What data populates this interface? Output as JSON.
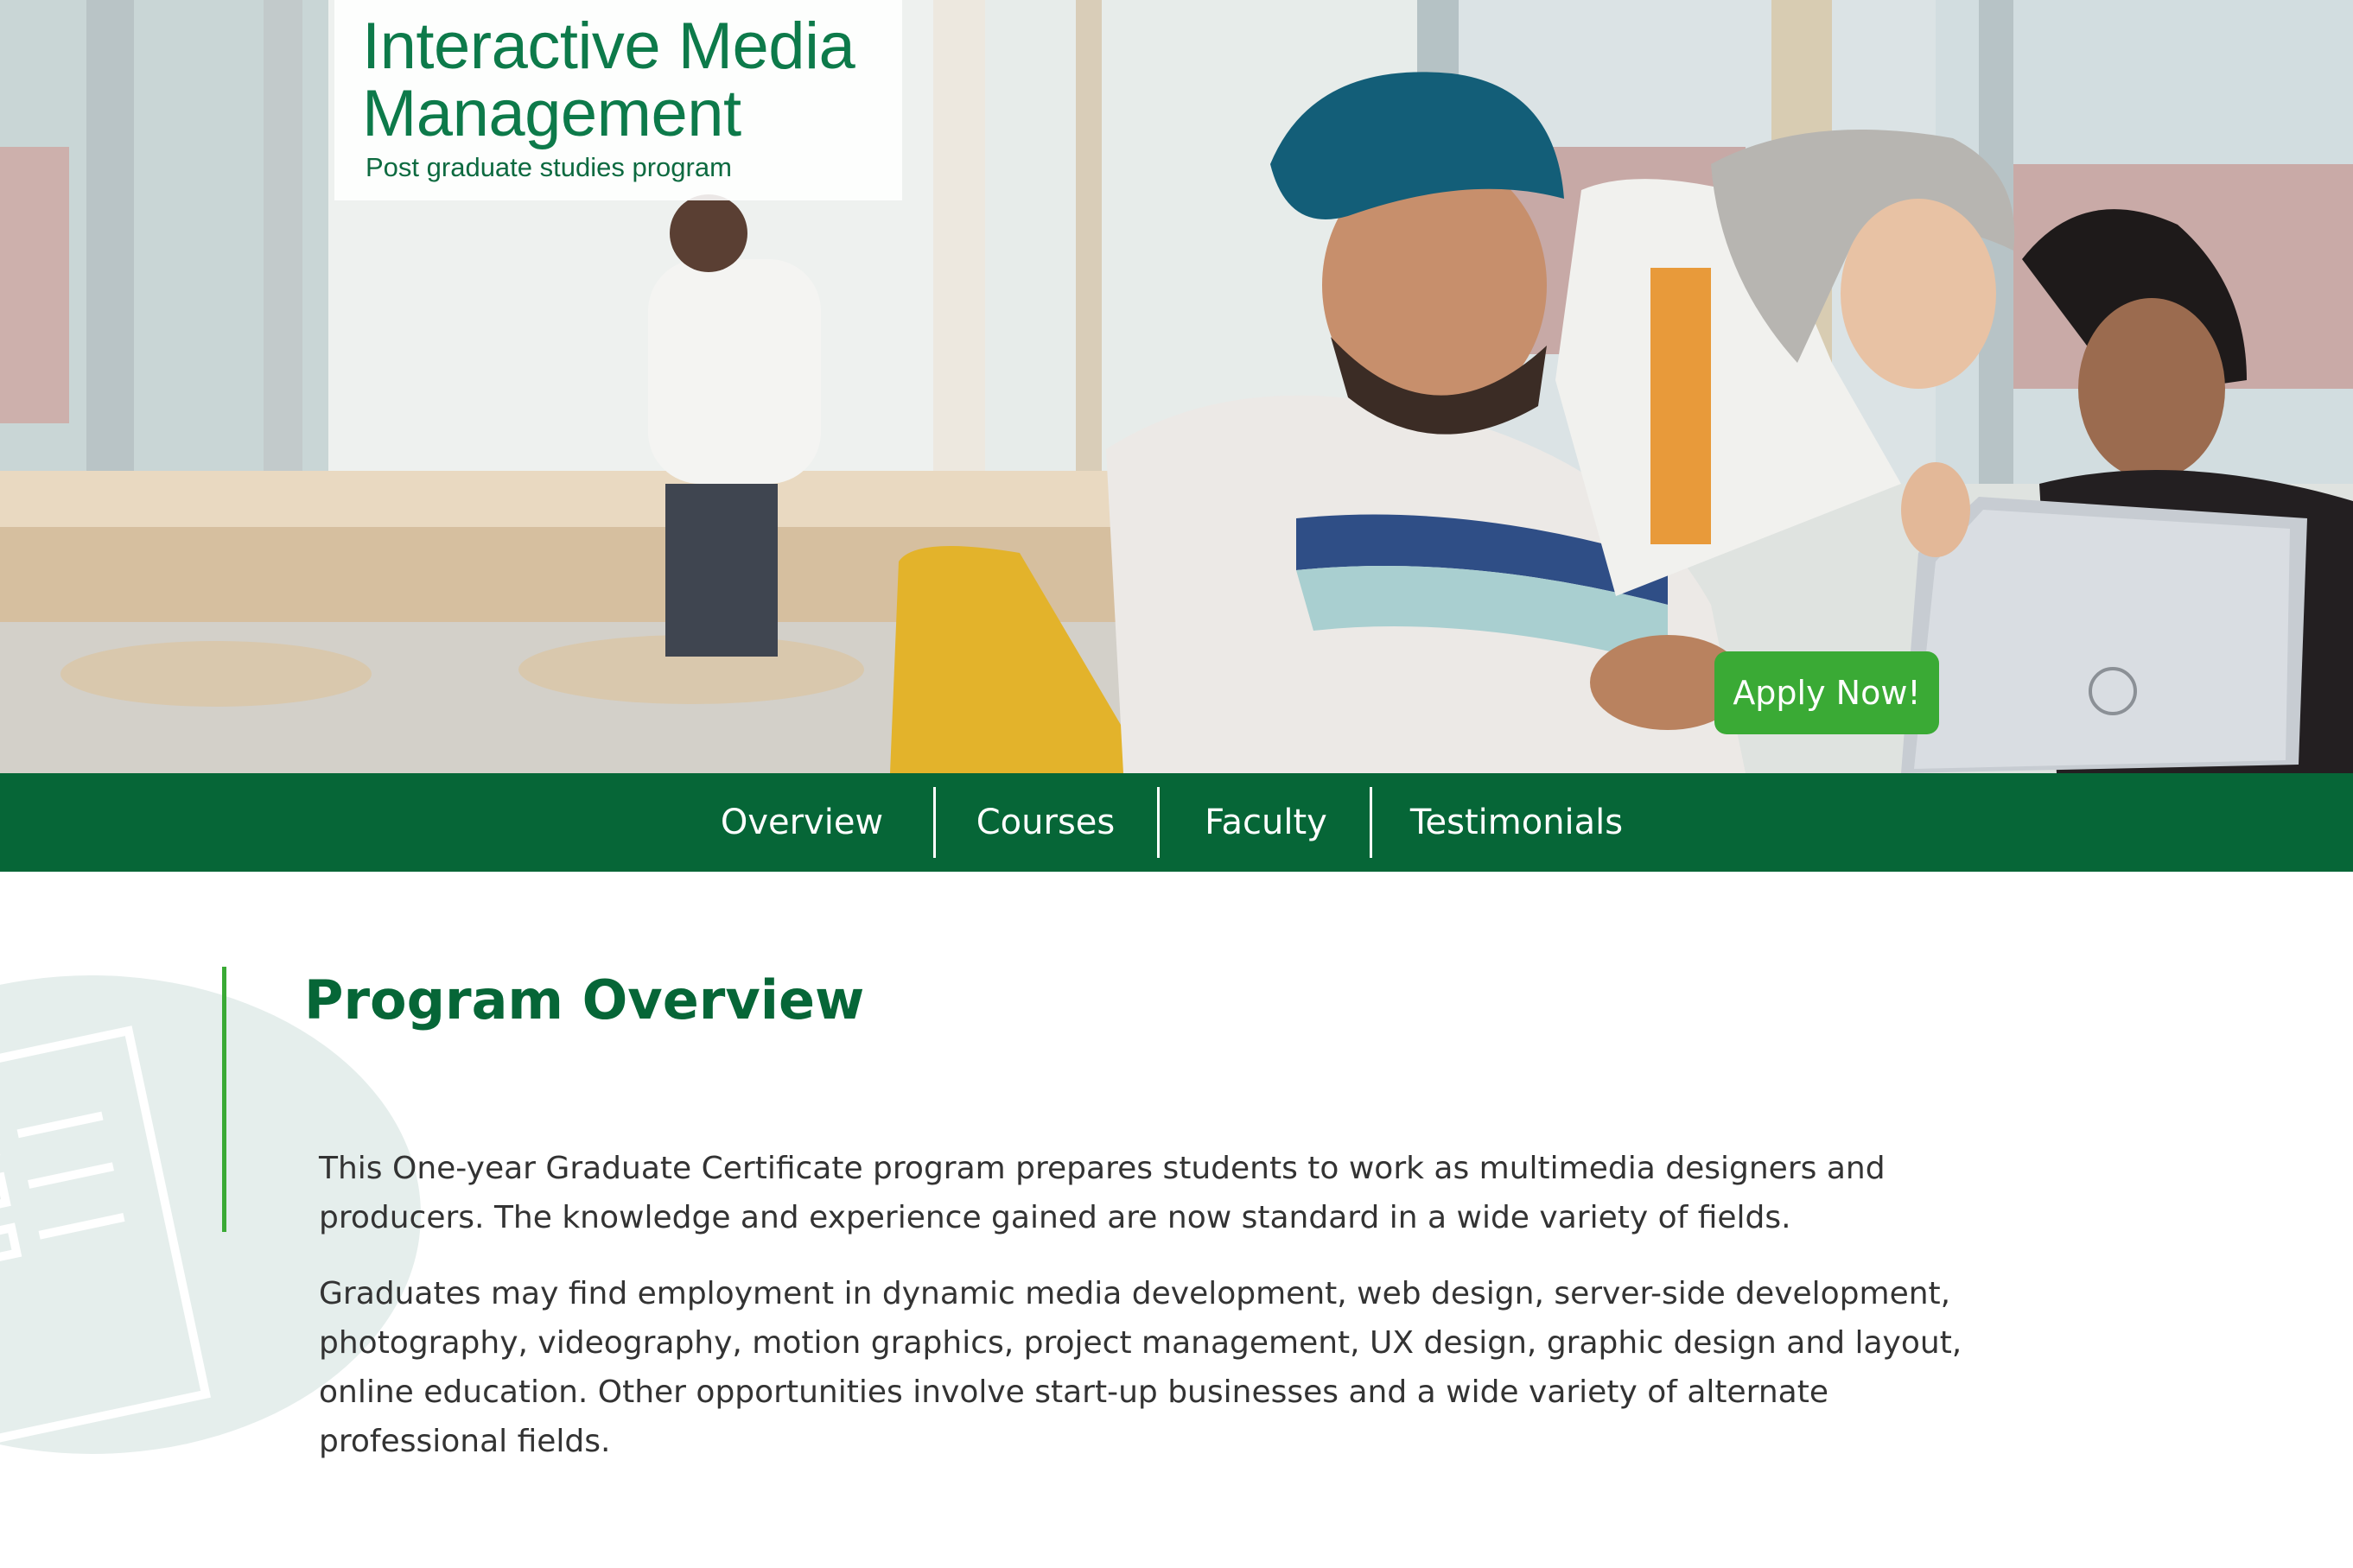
{
  "hero": {
    "program_title_line1": "Interactive Media",
    "program_title_line2": "Management",
    "program_subtitle": "Post graduate studies program",
    "apply_button": "Apply Now!"
  },
  "nav": {
    "items": [
      "Overview",
      "Courses",
      "Faculty",
      "Testimonials"
    ]
  },
  "overview": {
    "heading": "Program Overview",
    "paragraphs": [
      "This One-year Graduate Certificate program prepares students to work as multimedia designers and producers. The knowledge and experience gained are now standard in a wide variety of fields.",
      "Graduates may find employment in dynamic media development, web design, server-side development, photography, videography, motion graphics, project management, UX design, graphic design and layout, online education. Other opportunities involve start-up businesses and a wide variety of alternate professional fields."
    ]
  },
  "colors": {
    "brand_green": "#066637",
    "accent_green": "#3aaa35",
    "title_green": "#0d7a4a",
    "body_text": "#333333",
    "circle_tint": "#e5eeec"
  },
  "icons": {
    "section_icon": "checklist-icon"
  }
}
